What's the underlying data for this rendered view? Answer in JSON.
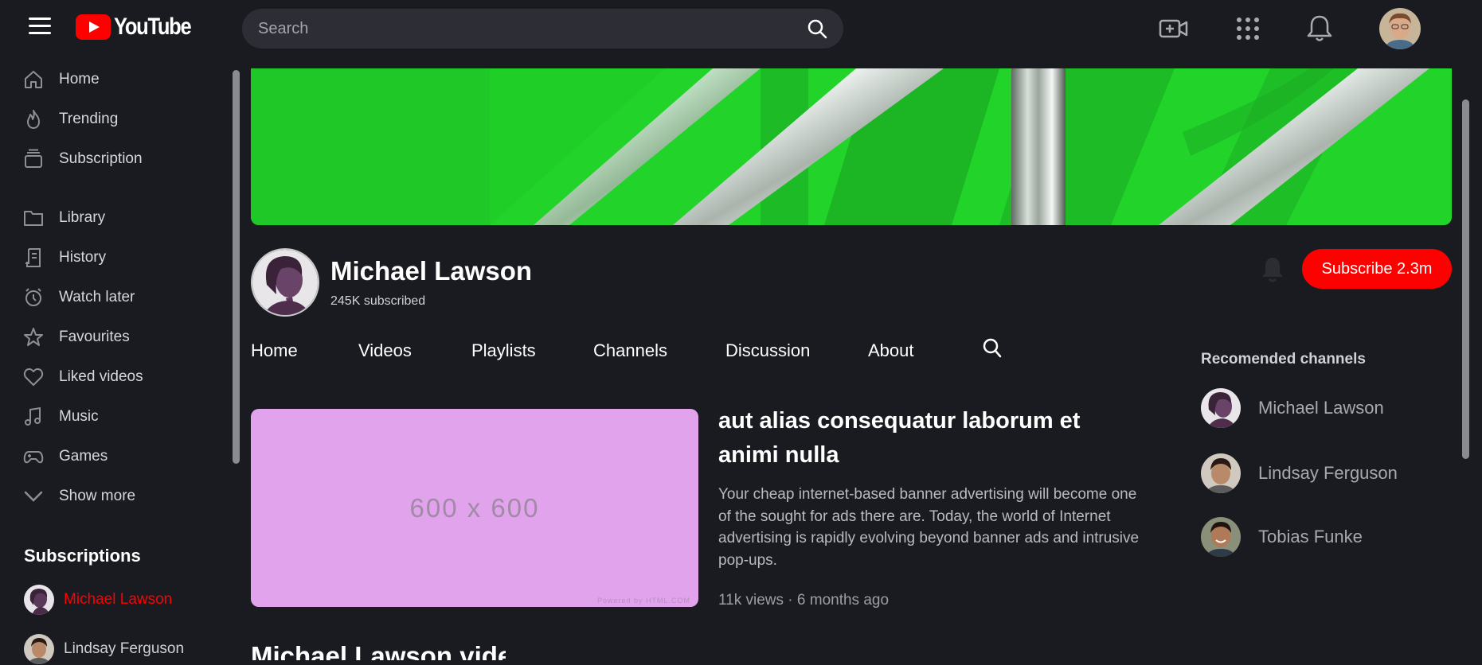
{
  "header": {
    "logo_text": "YouTube",
    "search_placeholder": "Search"
  },
  "sidebar": {
    "items": [
      {
        "label": "Home",
        "icon": "home-icon"
      },
      {
        "label": "Trending",
        "icon": "fire-icon"
      },
      {
        "label": "Subscription",
        "icon": "subscription-icon"
      },
      {
        "label": "Library",
        "icon": "folder-icon"
      },
      {
        "label": "History",
        "icon": "history-icon"
      },
      {
        "label": "Watch later",
        "icon": "clock-icon"
      },
      {
        "label": "Favourites",
        "icon": "star-icon"
      },
      {
        "label": "Liked videos",
        "icon": "heart-icon"
      },
      {
        "label": "Music",
        "icon": "music-icon"
      },
      {
        "label": "Games",
        "icon": "gamepad-icon"
      },
      {
        "label": "Show more",
        "icon": "chevron-down-icon"
      }
    ],
    "subscriptions_title": "Subscriptions",
    "subscriptions": [
      {
        "name": "Michael Lawson",
        "active": true
      },
      {
        "name": "Lindsay Ferguson",
        "active": false
      }
    ]
  },
  "channel": {
    "name": "Michael Lawson",
    "subscribed": "245K subscribed",
    "subscribe_label": "Subscribe 2.3m",
    "accent": "#ff0000"
  },
  "tabs": [
    "Home",
    "Videos",
    "Playlists",
    "Channels",
    "Discussion",
    "About"
  ],
  "featured": {
    "thumb_text": "600 x 600",
    "thumb_powered": "Powered by HTML.COM",
    "title": "aut alias consequatur laborum et animi nulla",
    "description": "Your cheap internet-based banner advertising will become one of the sought for ads there are. Today, the world of Internet advertising is rapidly evolving beyond banner ads and intrusive pop-ups.",
    "meta": "11k views · 6 months ago"
  },
  "next_section_title": "Michael Lawson videos",
  "recommended": {
    "title": "Recomended channels",
    "channels": [
      "Michael Lawson",
      "Lindsay Ferguson",
      "Tobias Funke"
    ]
  }
}
